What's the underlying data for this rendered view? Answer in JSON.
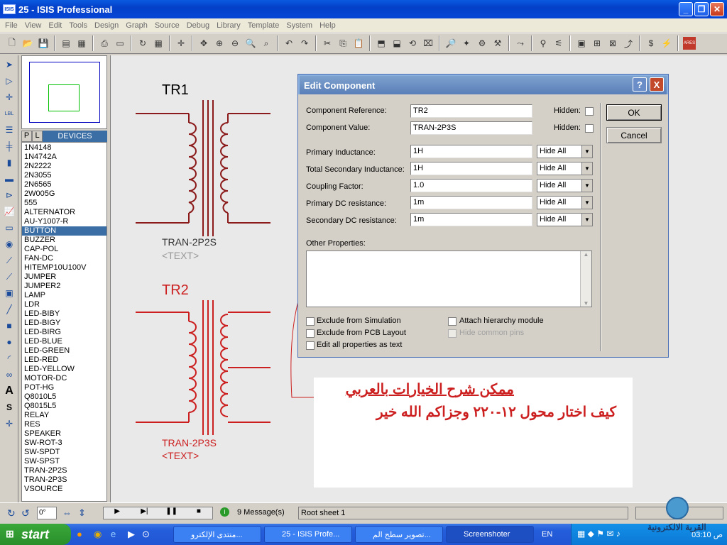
{
  "window": {
    "title": "25 - ISIS Professional",
    "logo": "ISIS"
  },
  "menu": [
    "File",
    "View",
    "Edit",
    "Tools",
    "Design",
    "Graph",
    "Source",
    "Debug",
    "Library",
    "Template",
    "System",
    "Help"
  ],
  "device_panel": {
    "tab_p": "P",
    "tab_l": "L",
    "header": "DEVICES",
    "selected": "BUTTON",
    "items": [
      "1N4148",
      "1N4742A",
      "2N2222",
      "2N3055",
      "2N6565",
      "2W005G",
      "555",
      "ALTERNATOR",
      "AU-Y1007-R",
      "BUTTON",
      "BUZZER",
      "CAP-POL",
      "FAN-DC",
      "HITEMP10U100V",
      "JUMPER",
      "JUMPER2",
      "LAMP",
      "LDR",
      "LED-BIBY",
      "LED-BIGY",
      "LED-BIRG",
      "LED-BLUE",
      "LED-GREEN",
      "LED-RED",
      "LED-YELLOW",
      "MOTOR-DC",
      "POT-HG",
      "Q8010L5",
      "Q8015L5",
      "RELAY",
      "RES",
      "SPEAKER",
      "SW-ROT-3",
      "SW-SPDT",
      "SW-SPST",
      "TRAN-2P2S",
      "TRAN-2P3S",
      "VSOURCE"
    ]
  },
  "schematic": {
    "tr1": {
      "ref": "TR1",
      "value": "TRAN-2P2S",
      "text": "<TEXT>",
      "color": "#8b1a1a"
    },
    "tr2": {
      "ref": "TR2",
      "value": "TRAN-2P3S",
      "text": "<TEXT>",
      "color": "#cc1f1f"
    }
  },
  "dialog": {
    "title": "Edit Component",
    "help_btn": "?",
    "close_btn": "X",
    "fields": [
      {
        "label": "Component Reference:",
        "value": "TR2",
        "hidden_label": "Hidden:"
      },
      {
        "label": "Component Value:",
        "value": "TRAN-2P3S",
        "hidden_label": "Hidden:"
      }
    ],
    "props": [
      {
        "label": "Primary Inductance:",
        "value": "1H",
        "option": "Hide All"
      },
      {
        "label": "Total Secondary Inductance:",
        "value": "1H",
        "option": "Hide All"
      },
      {
        "label": "Coupling Factor:",
        "value": "1.0",
        "option": "Hide All"
      },
      {
        "label": "Primary DC resistance:",
        "value": "1m",
        "option": "Hide All"
      },
      {
        "label": "Secondary DC resistance:",
        "value": "1m",
        "option": "Hide All"
      }
    ],
    "other_label": "Other Properties:",
    "ok": "OK",
    "cancel": "Cancel",
    "checks": {
      "exclude_sim": "Exclude from Simulation",
      "exclude_pcb": "Exclude from PCB Layout",
      "edit_all": "Edit all properties as text",
      "attach": "Attach hierarchy module",
      "hide_pins": "Hide common pins"
    }
  },
  "note": {
    "line1": "ممكن شرح الخيارات بالعربي",
    "line2": "كيف اختار محول ١٢-٢٢٠ وجزاكم الله خير"
  },
  "status": {
    "angle": "0°",
    "messages": "9 Message(s)",
    "sheet": "Root sheet 1"
  },
  "taskbar": {
    "start": "start",
    "tasks": [
      "منتدى الإلكترو...",
      "25 - ISIS Profe...",
      "تصوير سطح الم...",
      "Screenshoter"
    ],
    "lang": "EN",
    "clock": "03:10 ص"
  },
  "watermark": "القرية الالكترونية"
}
